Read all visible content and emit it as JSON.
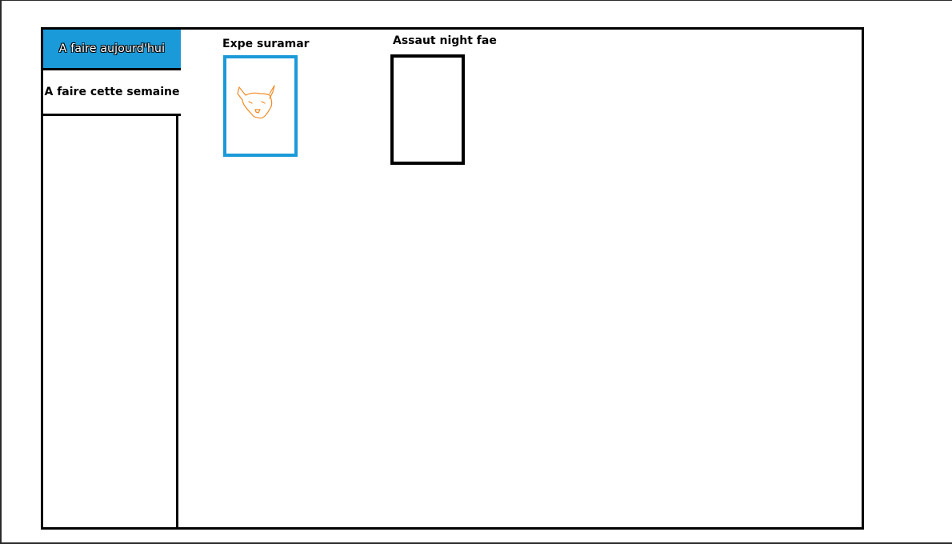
{
  "sidebar": {
    "items": [
      {
        "label": "A faire aujourd'hui",
        "active": true
      },
      {
        "label": "A faire cette semaine",
        "active": false
      }
    ]
  },
  "main": {
    "cards": [
      {
        "title": "Expe suramar",
        "icon": "fox-head-icon",
        "selected": true
      },
      {
        "title": "Assaut night fae",
        "icon": "",
        "selected": false
      }
    ]
  },
  "colors": {
    "accent": "#1a9ad9",
    "border": "#000000",
    "icon_stroke": "#f08a24"
  }
}
